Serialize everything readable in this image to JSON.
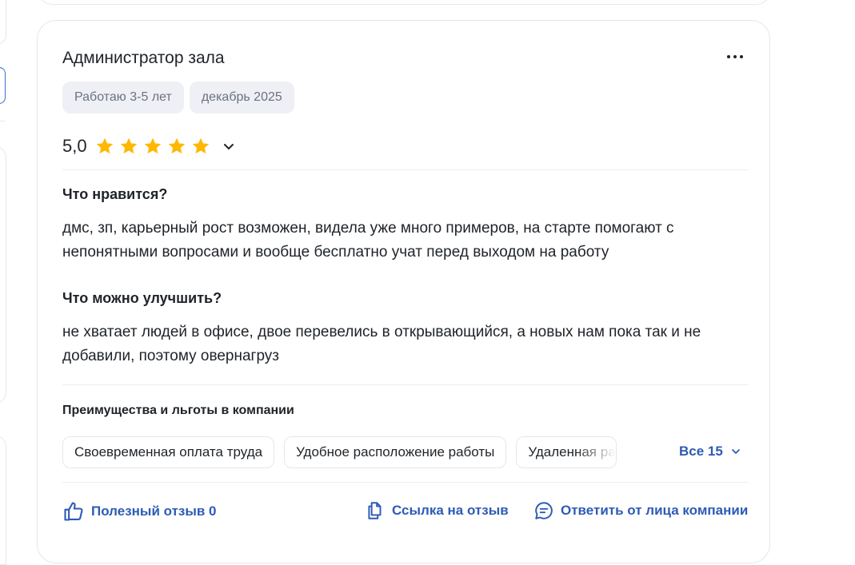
{
  "review": {
    "title": "Администратор зала",
    "tags": [
      "Работаю 3-5 лет",
      "декабрь 2025"
    ],
    "rating": "5,0",
    "rating_stars": 5,
    "likes_title": "Что нравится?",
    "likes_text": "дмс, зп, карьерный рост возможен, видела уже много примеров, на старте помогают с непонятными вопросами и вообще бесплатно учат перед выходом на работу",
    "improve_title": "Что можно улучшить?",
    "improve_text": "не хватает людей в офисе, двое перевелись в открывающийся, а новых нам пока так и не добавили, поэтому овернагруз",
    "benefits_title": "Преимущества и льготы в компании",
    "benefits": [
      "Своевременная оплата труда",
      "Удобное расположение работы",
      "Удаленная работа"
    ],
    "benefits_all": "Все 15",
    "actions": {
      "useful": "Полезный отзыв 0",
      "link": "Ссылка на отзыв",
      "reply": "Ответить от лица компании"
    }
  },
  "colors": {
    "star": "#ffb800",
    "link": "#2d5bb5",
    "tag_bg": "#eef0f5",
    "border": "#e4e7ee"
  },
  "icons": [
    "more-icon",
    "star-icon",
    "chevron-down-icon",
    "thumbs-up-icon",
    "copy-link-icon",
    "chat-bubble-icon"
  ]
}
